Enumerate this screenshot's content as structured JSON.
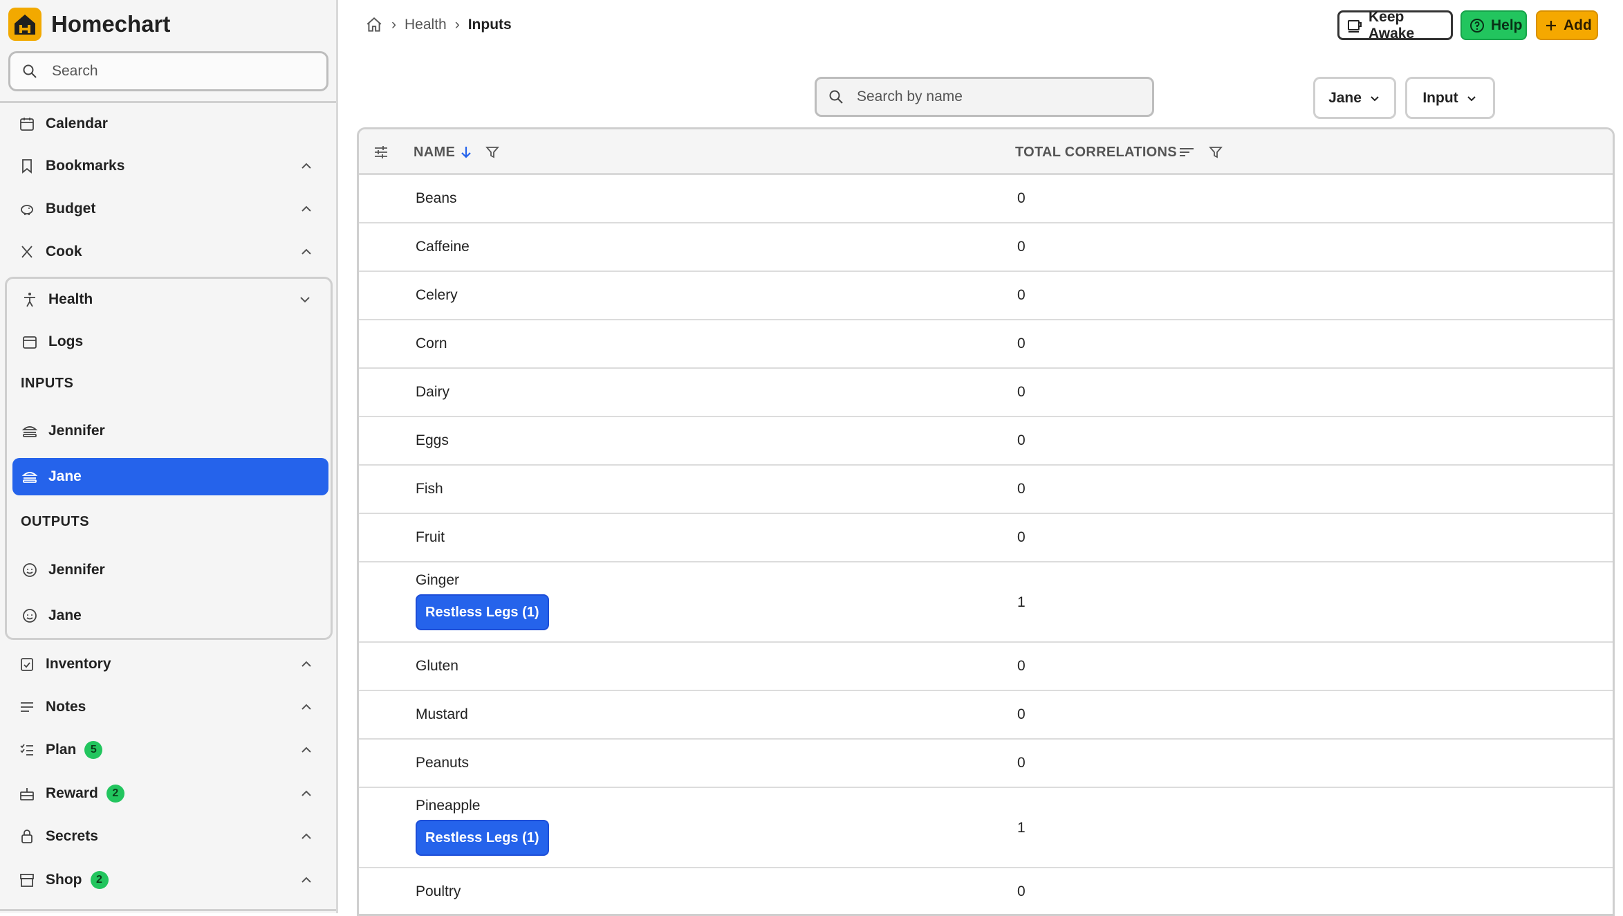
{
  "app": {
    "title": "Homechart"
  },
  "sidebar": {
    "search_placeholder": "Search",
    "items": [
      {
        "label": "Calendar",
        "icon": "calendar-icon"
      },
      {
        "label": "Bookmarks",
        "icon": "bookmark-icon"
      },
      {
        "label": "Budget",
        "icon": "piggy-bank-icon"
      },
      {
        "label": "Cook",
        "icon": "utensils-icon"
      }
    ],
    "health": {
      "label": "Health",
      "logs": "Logs",
      "inputs_label": "INPUTS",
      "inputs": [
        "Jennifer",
        "Jane"
      ],
      "outputs_label": "OUTPUTS",
      "outputs": [
        "Jennifer",
        "Jane"
      ]
    },
    "items_after": [
      {
        "label": "Inventory",
        "badge": ""
      },
      {
        "label": "Notes",
        "badge": ""
      },
      {
        "label": "Plan",
        "badge": "5"
      },
      {
        "label": "Reward",
        "badge": "2"
      },
      {
        "label": "Secrets",
        "badge": ""
      },
      {
        "label": "Shop",
        "badge": "2"
      }
    ]
  },
  "breadcrumb": {
    "section": "Health",
    "current": "Inputs"
  },
  "toolbar": {
    "keep_awake": "Keep Awake",
    "help": "Help",
    "add": "Add"
  },
  "filters": {
    "search_placeholder": "Search by name",
    "person": "Jane",
    "type": "Input"
  },
  "table": {
    "columns": {
      "name": "NAME",
      "total": "TOTAL CORRELATIONS"
    },
    "rows": [
      {
        "name": "Beans",
        "total": "0",
        "tag": ""
      },
      {
        "name": "Caffeine",
        "total": "0",
        "tag": ""
      },
      {
        "name": "Celery",
        "total": "0",
        "tag": ""
      },
      {
        "name": "Corn",
        "total": "0",
        "tag": ""
      },
      {
        "name": "Dairy",
        "total": "0",
        "tag": ""
      },
      {
        "name": "Eggs",
        "total": "0",
        "tag": ""
      },
      {
        "name": "Fish",
        "total": "0",
        "tag": ""
      },
      {
        "name": "Fruit",
        "total": "0",
        "tag": ""
      },
      {
        "name": "Ginger",
        "total": "1",
        "tag": "Restless Legs (1)"
      },
      {
        "name": "Gluten",
        "total": "0",
        "tag": ""
      },
      {
        "name": "Mustard",
        "total": "0",
        "tag": ""
      },
      {
        "name": "Peanuts",
        "total": "0",
        "tag": ""
      },
      {
        "name": "Pineapple",
        "total": "1",
        "tag": "Restless Legs (1)"
      },
      {
        "name": "Poultry",
        "total": "0",
        "tag": ""
      }
    ]
  },
  "colors": {
    "accent": "#2563eb",
    "help": "#22c55e",
    "add": "#f5a800",
    "brand": "#f2a900"
  }
}
